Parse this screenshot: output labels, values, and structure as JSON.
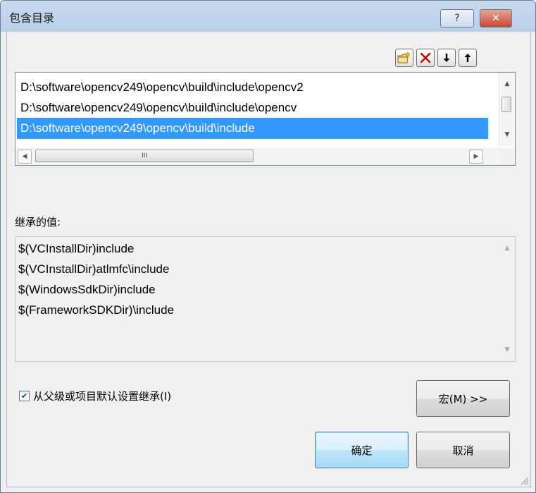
{
  "window": {
    "title": "包含目录",
    "help_label": "?",
    "close_label": "✕"
  },
  "toolbar": {
    "icons": [
      "new-folder-icon",
      "delete-icon",
      "move-down-icon",
      "move-up-icon"
    ],
    "delete_color": "#cc0000"
  },
  "directory_list": {
    "items": [
      {
        "text": "D:\\software\\opencv249\\opencv\\build\\include\\opencv2",
        "selected": false
      },
      {
        "text": "D:\\software\\opencv249\\opencv\\build\\include\\opencv",
        "selected": false
      },
      {
        "text": "D:\\software\\opencv249\\opencv\\build\\include",
        "selected": true
      }
    ],
    "selection_color": "#3399ff",
    "hscroll_thumb_label": "III"
  },
  "inherited": {
    "label": "继承的值:",
    "lines": [
      "$(VCInstallDir)include",
      "$(VCInstallDir)atlmfc\\include",
      "$(WindowsSdkDir)include",
      "$(FrameworkSDKDir)\\include"
    ]
  },
  "inherit_checkbox": {
    "checked": true,
    "label": "从父级或项目默认设置继承(I)"
  },
  "buttons": {
    "macros": "宏(M) >>",
    "ok": "确定",
    "cancel": "取消"
  }
}
